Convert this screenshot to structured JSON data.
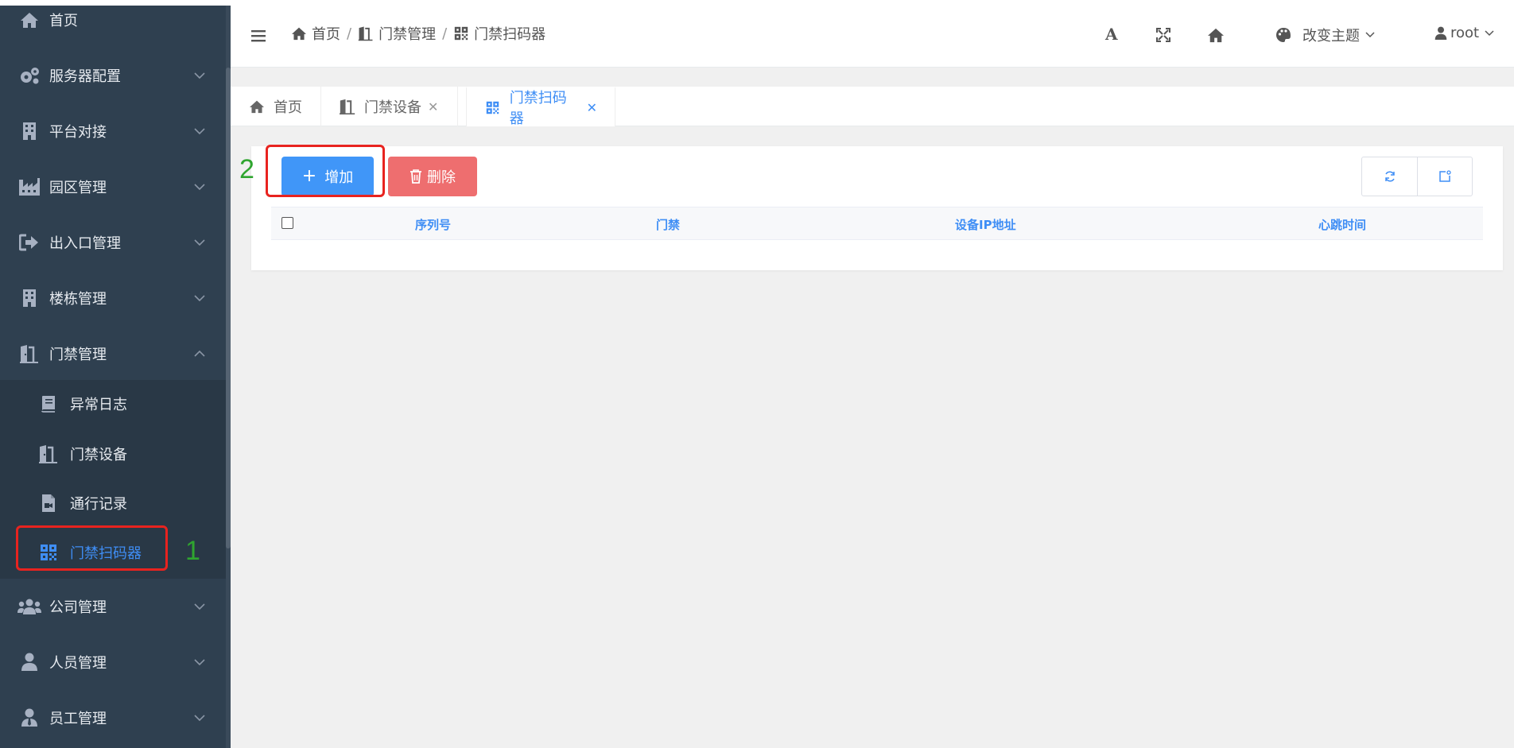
{
  "sidebar": {
    "home_label": "首页",
    "items": [
      {
        "label": "服务器配置",
        "icon": "gears-icon"
      },
      {
        "label": "平台对接",
        "icon": "building-icon"
      },
      {
        "label": "园区管理",
        "icon": "industry-icon"
      },
      {
        "label": "出入口管理",
        "icon": "sign-out-icon"
      },
      {
        "label": "楼栋管理",
        "icon": "building-icon"
      },
      {
        "label": "门禁管理",
        "icon": "door-icon",
        "expanded": true
      }
    ],
    "sub_items": [
      {
        "label": "异常日志",
        "icon": "book-icon"
      },
      {
        "label": "门禁设备",
        "icon": "door-icon"
      },
      {
        "label": "通行记录",
        "icon": "video-file-icon"
      },
      {
        "label": "门禁扫码器",
        "icon": "qrcode-icon",
        "active": true
      }
    ],
    "items_after": [
      {
        "label": "公司管理",
        "icon": "users-icon"
      },
      {
        "label": "人员管理",
        "icon": "user-icon"
      },
      {
        "label": "员工管理",
        "icon": "user-tie-icon"
      }
    ]
  },
  "header": {
    "breadcrumb": [
      "首页",
      "门禁管理",
      "门禁扫码器"
    ],
    "font_icon_label": "A",
    "theme_label": "改变主题",
    "user_label": "root"
  },
  "tabs": [
    {
      "label": "首页",
      "closable": false
    },
    {
      "label": "门禁设备",
      "closable": true
    },
    {
      "label": "门禁扫码器",
      "closable": true,
      "active": true
    }
  ],
  "toolbar": {
    "add_label": "增加",
    "delete_label": "删除"
  },
  "table": {
    "columns": [
      "序列号",
      "门禁",
      "设备IP地址",
      "心跳时间"
    ],
    "rows": []
  },
  "annotations": {
    "marker_1": "1",
    "marker_2": "2"
  },
  "colors": {
    "sidebar_bg": "#2f4050",
    "accent_blue": "#3f8ef5",
    "add_button": "#4096f8",
    "delete_button": "#ee6e6f",
    "highlight_red": "#e8231f",
    "annotation_green": "#2fa52f"
  }
}
